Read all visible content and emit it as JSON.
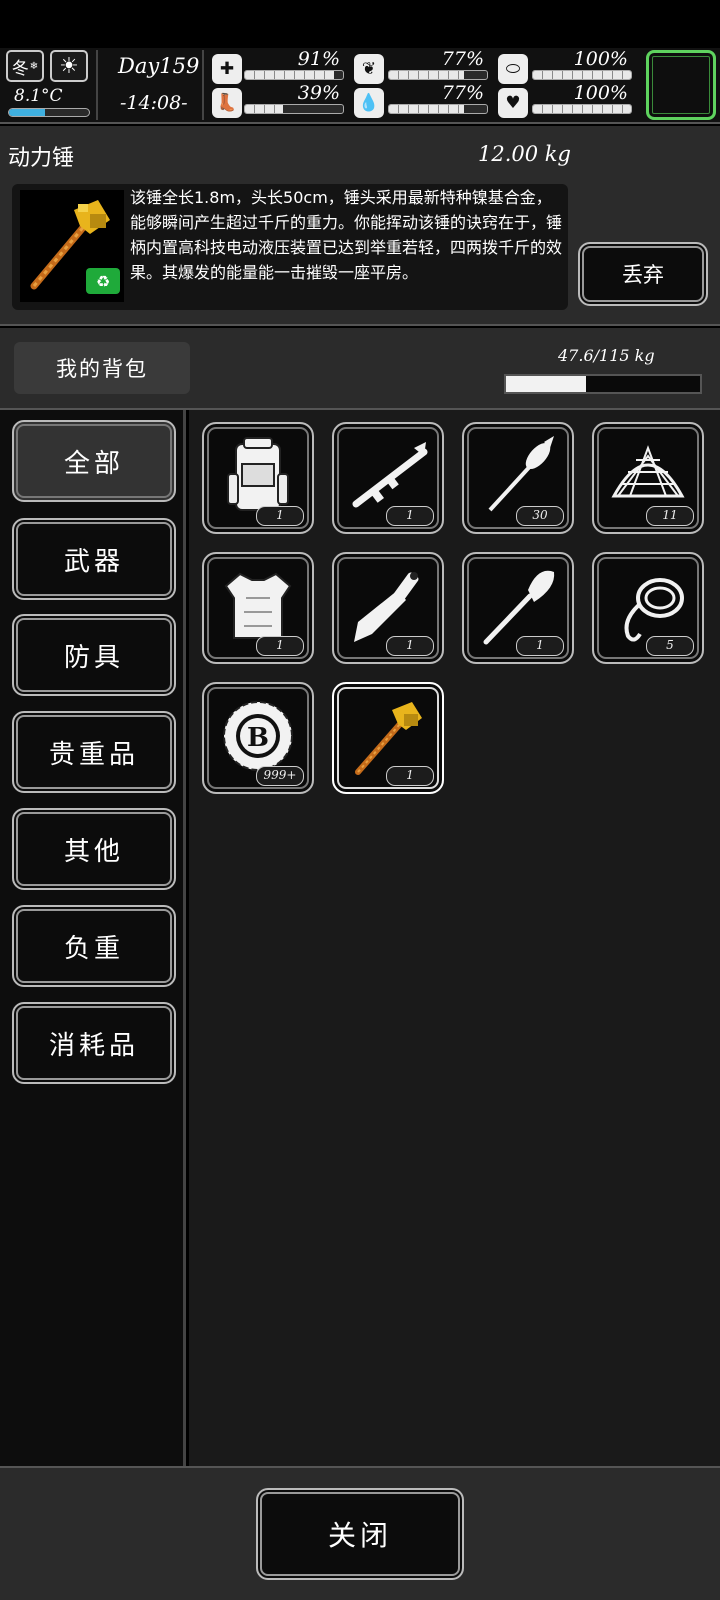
{
  "hud": {
    "season": "冬",
    "weather_icon": "sun-icon",
    "temperature": "8.1°C",
    "temperature_level": 0.45,
    "day": "Day159",
    "time": "-14:08-",
    "stats": [
      {
        "icon": "medkit-icon",
        "value": "91%",
        "level": 0.91
      },
      {
        "icon": "stomach-icon",
        "value": "77%",
        "level": 0.77
      },
      {
        "icon": "pill-icon",
        "value": "100%",
        "level": 1.0
      },
      {
        "icon": "boot-icon",
        "value": "39%",
        "level": 0.39
      },
      {
        "icon": "water-drop-icon",
        "value": "77%",
        "level": 0.77
      },
      {
        "icon": "heart-icon",
        "value": "100%",
        "level": 1.0
      }
    ],
    "status_frame_color": "#5fd35f"
  },
  "detail": {
    "name": "动力锤",
    "weight": "12.00 kg",
    "description": "该锤全长1.8m，头长50cm，锤头采用最新特种镍基合金，能够瞬间产生超过千斤的重力。你能挥动该锤的诀窍在于，锤柄内置高科技电动液压装置已达到举重若轻，四两拨千斤的效果。其爆发的能量能一击摧毁一座平房。",
    "icon": "power-hammer-icon",
    "badge_icon": "recycle-shirt-icon",
    "discard_label": "丢弃"
  },
  "backpack": {
    "title": "我的背包",
    "capacity": "47.6/115 kg",
    "capacity_level": 0.414
  },
  "categories": [
    "全部",
    "武器",
    "防具",
    "贵重品",
    "其他",
    "负重",
    "消耗品"
  ],
  "items": [
    {
      "icon": "backpack-icon",
      "count": "1"
    },
    {
      "icon": "rpg-launcher-icon",
      "count": "1"
    },
    {
      "icon": "rocket-icon",
      "count": "30"
    },
    {
      "icon": "net-icon",
      "count": "11"
    },
    {
      "icon": "body-armor-icon",
      "count": "1"
    },
    {
      "icon": "machete-icon",
      "count": "1"
    },
    {
      "icon": "shovel-icon",
      "count": "1"
    },
    {
      "icon": "rope-icon",
      "count": "5"
    },
    {
      "icon": "bitcoin-icon",
      "count": "999+"
    },
    {
      "icon": "power-hammer-icon",
      "count": "1"
    }
  ],
  "close_label": "关闭"
}
